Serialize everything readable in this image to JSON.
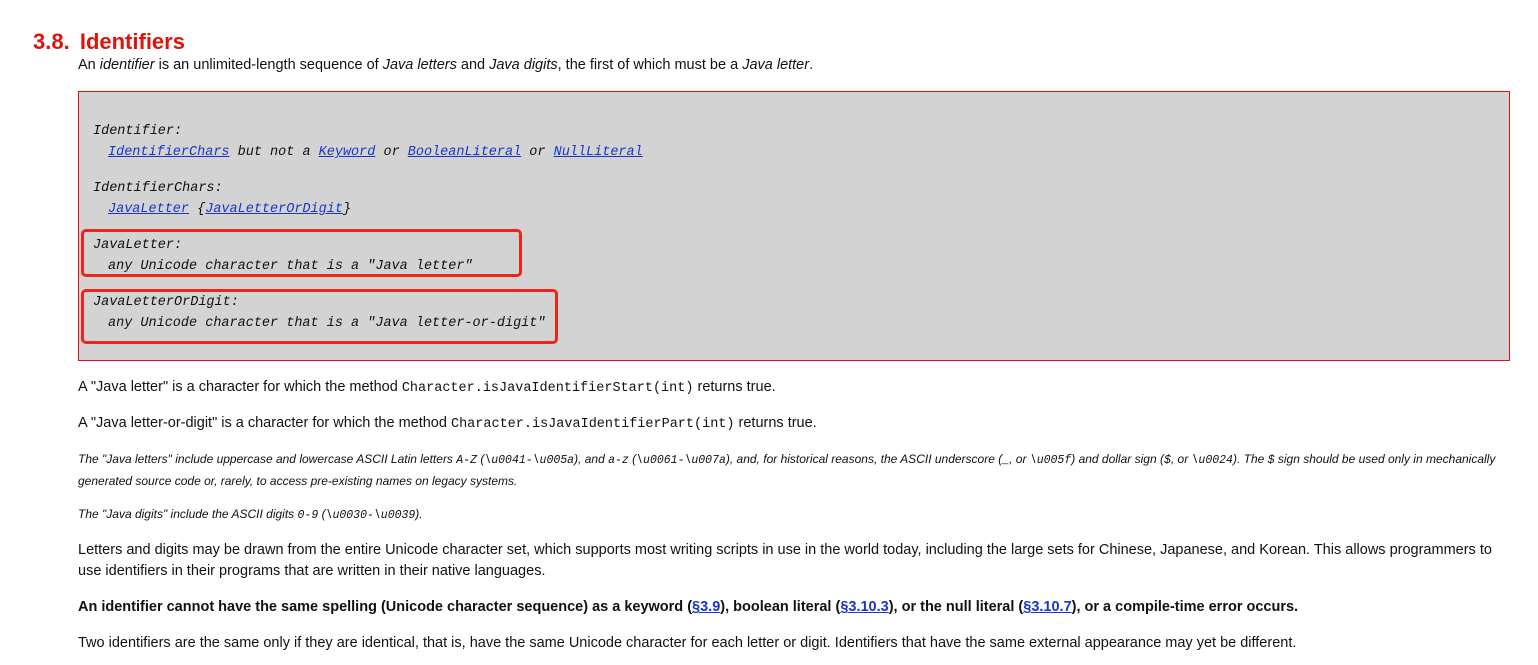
{
  "section": {
    "number": "3.8.",
    "title": "Identifiers"
  },
  "intro": {
    "t1": "An ",
    "i1": "identifier",
    "t2": " is an unlimited-length sequence of ",
    "i2": "Java letters",
    "t3": " and ",
    "i3": "Java digits",
    "t4": ", the first of which must be a ",
    "i4": "Java letter",
    "t5": "."
  },
  "grammar": {
    "identifier": {
      "lhs": "Identifier:",
      "link1": "IdentifierChars",
      "mid1": " but not a ",
      "link2": "Keyword",
      "mid2": " or ",
      "link3": "BooleanLiteral",
      "mid3": " or ",
      "link4": "NullLiteral"
    },
    "identifier_chars": {
      "lhs": "IdentifierChars:",
      "link1": "JavaLetter",
      "open": " {",
      "link2": "JavaLetterOrDigit",
      "close": "}"
    },
    "java_letter": {
      "lhs": "JavaLetter:",
      "rhs": "any Unicode character that is a \"Java letter\""
    },
    "java_letter_or_digit": {
      "lhs": "JavaLetterOrDigit:",
      "rhs": "any Unicode character that is a \"Java letter-or-digit\""
    }
  },
  "para_letter": {
    "t1": "A \"Java letter\" is a character for which the method ",
    "code": "Character.isJavaIdentifierStart(int)",
    "t2": " returns true."
  },
  "para_letter_or_digit": {
    "t1": "A \"Java letter-or-digit\" is a character for which the method ",
    "code": "Character.isJavaIdentifierPart(int)",
    "t2": " returns true."
  },
  "note_letters": {
    "t1": "The \"Java letters\" include uppercase and lowercase ASCII Latin letters ",
    "c1": "A-Z",
    "t2": " (",
    "c2": "\\u0041-\\u005a",
    "t3": "), and ",
    "c3": "a-z",
    "t4": " (",
    "c4": "\\u0061-\\u007a",
    "t5": "), and, for historical reasons, the ASCII underscore (",
    "c5": "_",
    "t6": ", or ",
    "c6": "\\u005f",
    "t7": ") and dollar sign (",
    "c7": "$",
    "t8": ", or ",
    "c8": "\\u0024",
    "t9": "). The ",
    "c9": "$",
    "t10": " sign should be used only in mechanically generated source code or, rarely, to access pre-existing names on legacy systems."
  },
  "note_digits": {
    "t1": "The \"Java digits\" include the ASCII digits ",
    "c1": "0-9",
    "t2": " (",
    "c2": "\\u0030-\\u0039",
    "t3": ")."
  },
  "para_unicode": "Letters and digits may be drawn from the entire Unicode character set, which supports most writing scripts in use in the world today, including the large sets for Chinese, Japanese, and Korean. This allows programmers to use identifiers in their programs that are written in their native languages.",
  "para_rule": {
    "t1": "An identifier cannot have the same spelling (Unicode character sequence) as a keyword (",
    "l1": "§3.9",
    "t2": "), boolean literal (",
    "l2": "§3.10.3",
    "t3": "), or the null literal (",
    "l3": "§3.10.7",
    "t4": "), or a compile-time error occurs."
  },
  "para_same": "Two identifiers are the same only if they are identical, that is, have the same Unicode character for each letter or digit. Identifiers that have the same external appearance may yet be different.",
  "colors": {
    "heading": "#e2120a",
    "link": "#1a36c9",
    "highlight": "#f0221b",
    "grammar_bg": "#d3d3d3"
  }
}
